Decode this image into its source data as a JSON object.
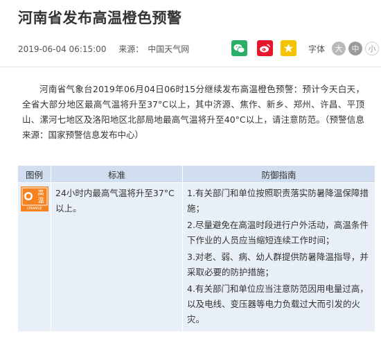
{
  "article": {
    "title": "河南省发布高温橙色预警",
    "datetime": "2019-06-04 06:15:00",
    "source_label": "来源：",
    "source_name": "中国天气网",
    "body": "河南省气象台2019年06月04日06时15分继续发布高温橙色预警：预计今天白天，全省大部分地区最高气温将升至37°C以上，其中济源、焦作、新乡、郑州、许昌、平顶山、漯河七地区及洛阳地区北部局地最高气温将升至40°C以上，请注意防范。（预警信息来源：国家预警信息发布中心）"
  },
  "share": {
    "icons": [
      "wechat-icon",
      "weibo-icon",
      "qzone-icon"
    ],
    "colors": {
      "wechat": "#2aae67",
      "weibo": "#e6162d",
      "qzone": "#f5c400"
    }
  },
  "font_size": {
    "label": "字体",
    "options": [
      "大",
      "中",
      "小"
    ],
    "selected": "中"
  },
  "warning_table": {
    "headers": [
      "图例",
      "标准",
      "防御指南"
    ],
    "icon": {
      "name": "high-temperature-orange-warning-icon",
      "text_top": "高",
      "text_bottom": "温",
      "caption": "ORANGE",
      "color": "#f58220"
    },
    "standard": "24小时内最高气温将升至37°C以上。",
    "guides": [
      "1.有关部门和单位按照职责落实防暑降温保障措施；",
      "2.尽量避免在高温时段进行户外活动，高温条件下作业的人员应当缩短连续工作时间；",
      "3.对老、弱、病、幼人群提供防暑降温指导，并采取必要的防护措施；",
      "4.有关部门和单位应当注意防范因用电量过高，以及电线、变压器等电力负载过大而引发的火灾。"
    ]
  }
}
